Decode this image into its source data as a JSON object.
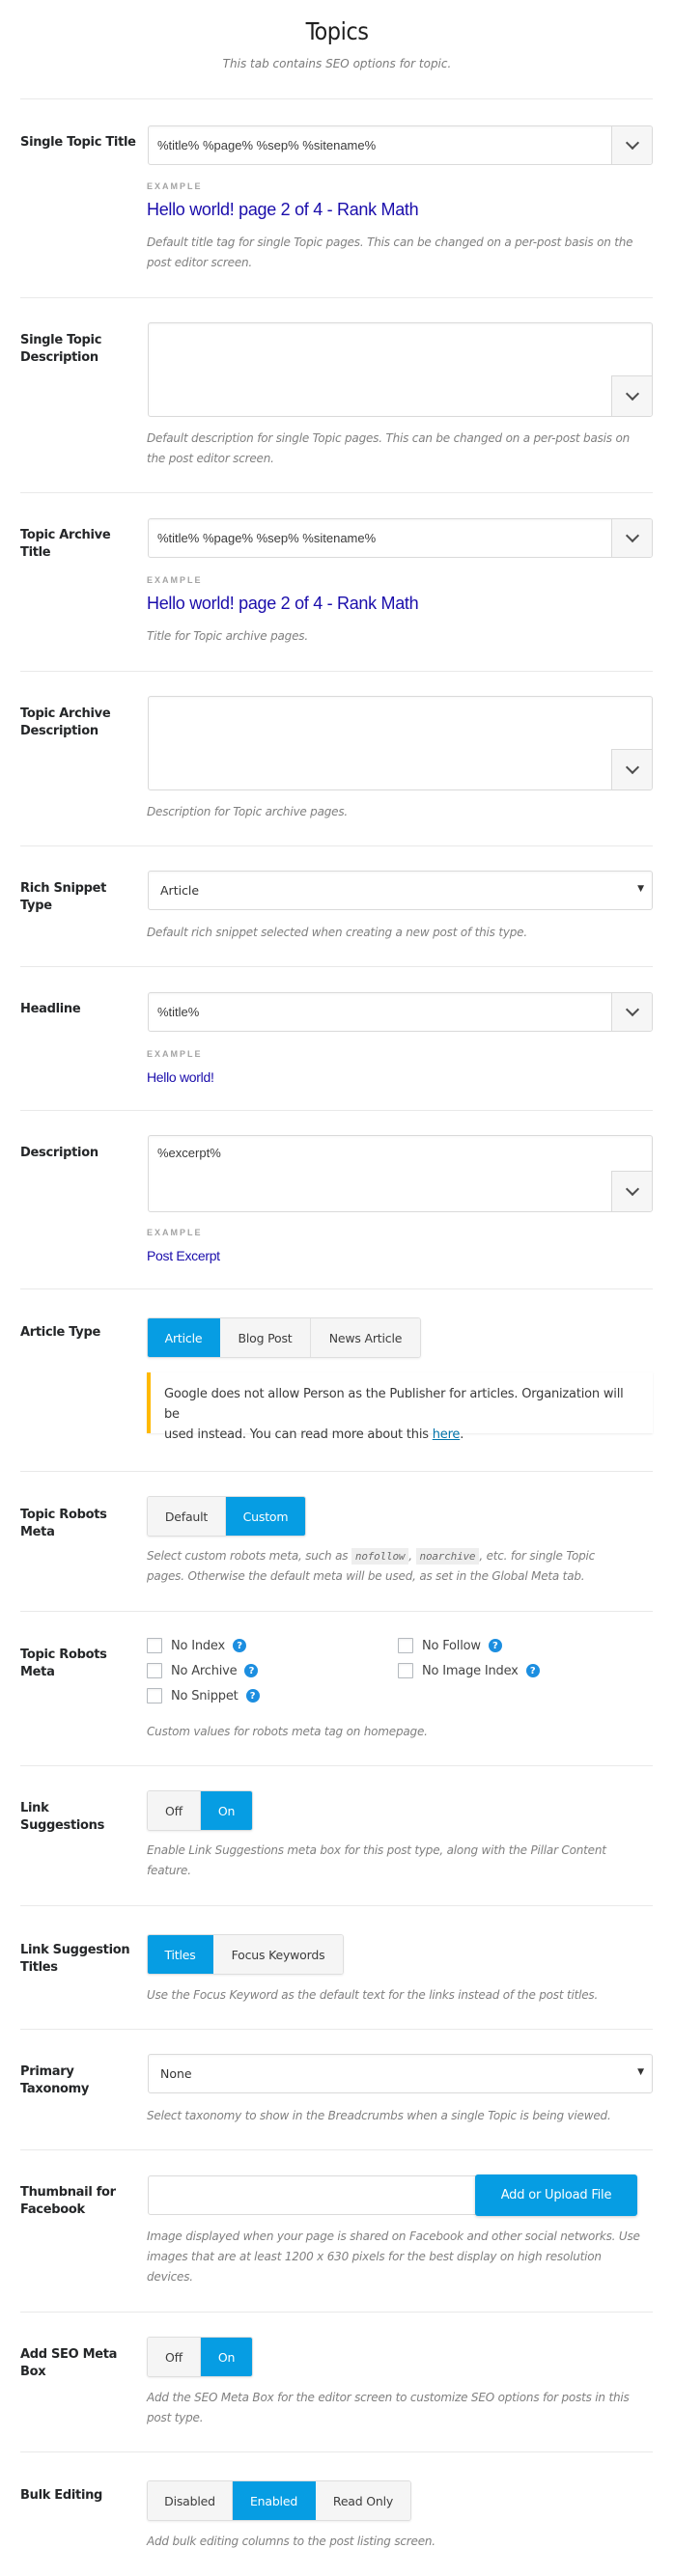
{
  "header": {
    "title": "Topics",
    "subtitle": "This tab contains SEO options for topic."
  },
  "colors": {
    "accent": "#069de3",
    "example_link": "#1a0dab",
    "notice_border": "#ffb900",
    "help_icon": "#1c8ee0"
  },
  "single_topic_title": {
    "label": "Single Topic Title",
    "value": "%title% %page% %sep% %sitename%",
    "example_label": "EXAMPLE",
    "example": "Hello world! page 2 of 4 - Rank Math",
    "help_line1": "Default title tag for single Topic pages. This can be changed on a per-post basis on the",
    "help_line2": "post editor screen."
  },
  "single_topic_description": {
    "label": "Single Topic Description",
    "value": "",
    "help_line1": "Default description for single Topic pages. This can be changed on a per-post basis on",
    "help_line2": "the post editor screen."
  },
  "topic_archive_title": {
    "label": "Topic Archive Title",
    "value": "%title% %page% %sep% %sitename%",
    "example_label": "EXAMPLE",
    "example": "Hello world! page 2 of 4 - Rank Math",
    "help": "Title for Topic archive pages."
  },
  "topic_archive_description": {
    "label": "Topic Archive Description",
    "value": "",
    "help": "Description for Topic archive pages."
  },
  "rich_snippet_type": {
    "label": "Rich Snippet Type",
    "selected": "Article",
    "help": "Default rich snippet selected when creating a new post of this type."
  },
  "headline": {
    "label": "Headline",
    "value": "%title%",
    "example_label": "EXAMPLE",
    "example": "Hello world!"
  },
  "description": {
    "label": "Description",
    "value": "%excerpt%",
    "example_label": "EXAMPLE",
    "example": "Post Excerpt"
  },
  "article_type": {
    "label": "Article Type",
    "options": [
      "Article",
      "Blog Post",
      "News Article"
    ],
    "selected": "Article",
    "notice_line1": "Google does not allow Person as the Publisher for articles. Organization will be",
    "notice_line2_prefix": "used instead. You can read more about this ",
    "notice_link": "here",
    "notice_line2_suffix": "."
  },
  "topic_robots_meta_mode": {
    "label": "Topic Robots Meta",
    "options": [
      "Default",
      "Custom"
    ],
    "selected": "Custom",
    "help_prefix": "Select custom robots meta, such as ",
    "code1": "nofollow",
    "help_mid": ", ",
    "code2": "noarchive",
    "help_suffix": ", etc. for single Topic",
    "help_line2": "pages. Otherwise the default meta will be used, as set in the Global Meta tab."
  },
  "topic_robots_meta_values": {
    "label": "Topic Robots Meta",
    "checkboxes": [
      {
        "label": "No Index",
        "checked": false
      },
      {
        "label": "No Follow",
        "checked": false
      },
      {
        "label": "No Archive",
        "checked": false
      },
      {
        "label": "No Image Index",
        "checked": false
      },
      {
        "label": "No Snippet",
        "checked": false
      }
    ],
    "help_icon_glyph": "?",
    "help": "Custom values for robots meta tag on homepage."
  },
  "link_suggestions": {
    "label": "Link Suggestions",
    "options": [
      "Off",
      "On"
    ],
    "selected": "On",
    "help_line1": "Enable Link Suggestions meta box for this post type, along with the Pillar Content",
    "help_line2": "feature."
  },
  "link_suggestion_titles": {
    "label": "Link Suggestion Titles",
    "options": [
      "Titles",
      "Focus Keywords"
    ],
    "selected": "Titles",
    "help": "Use the Focus Keyword as the default text for the links instead of the post titles."
  },
  "primary_taxonomy": {
    "label": "Primary Taxonomy",
    "selected": "None",
    "help": "Select taxonomy to show in the Breadcrumbs when a single Topic is being viewed."
  },
  "thumbnail_facebook": {
    "label": "Thumbnail for Facebook",
    "value": "",
    "button": "Add or Upload File",
    "help_line1": "Image displayed when your page is shared on Facebook and other social networks. Use",
    "help_line2": "images that are at least 1200 x 630 pixels for the best display on high resolution",
    "help_line3": "devices."
  },
  "add_seo_meta_box": {
    "label": "Add SEO Meta Box",
    "options": [
      "Off",
      "On"
    ],
    "selected": "On",
    "help_line1": "Add the SEO Meta Box for the editor screen to customize SEO options for posts in this",
    "help_line2": "post type."
  },
  "bulk_editing": {
    "label": "Bulk Editing",
    "options": [
      "Disabled",
      "Enabled",
      "Read Only"
    ],
    "selected": "Enabled",
    "help": "Add bulk editing columns to the post listing screen."
  }
}
